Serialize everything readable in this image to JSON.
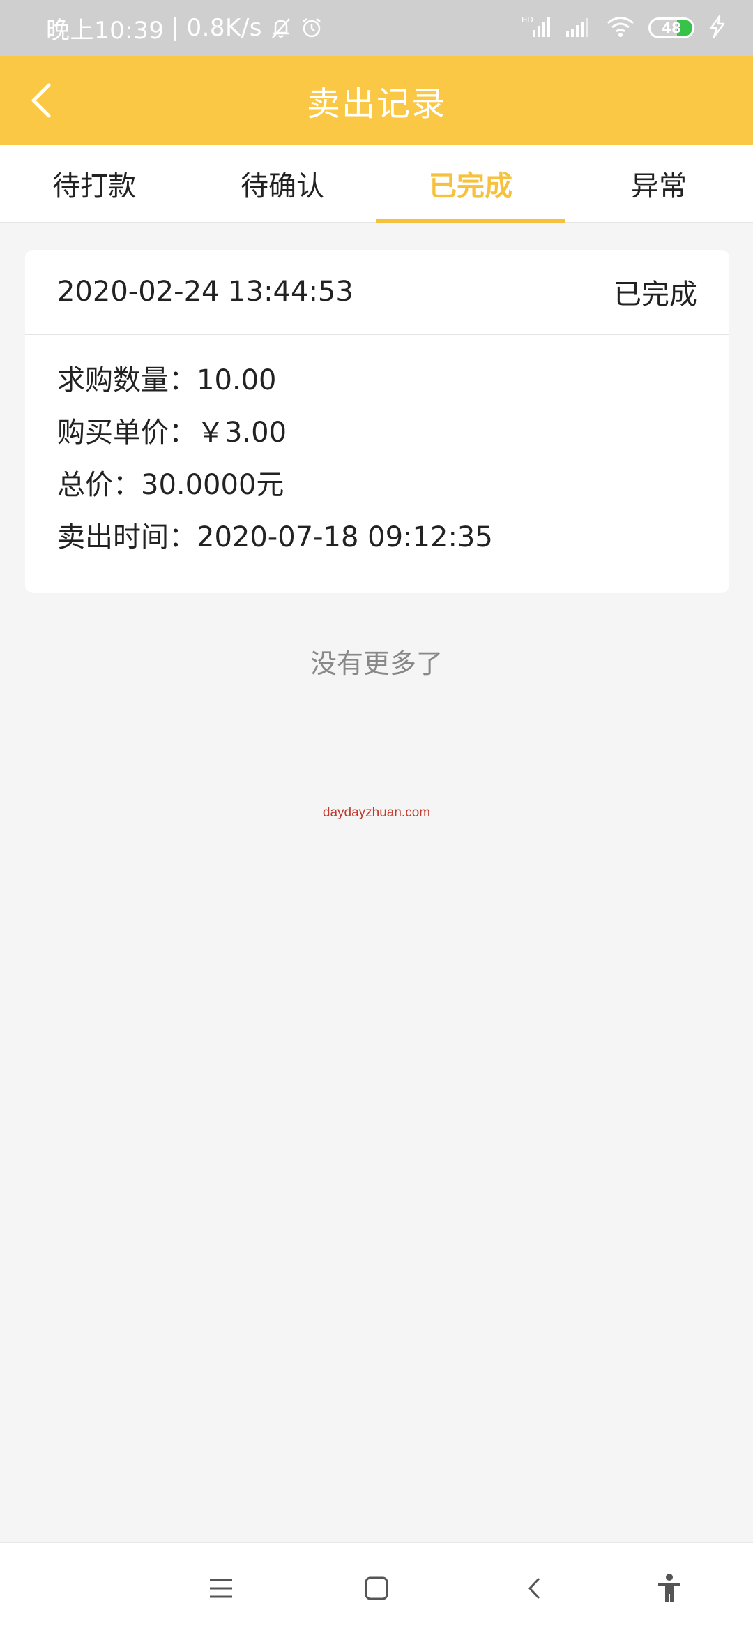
{
  "status_bar": {
    "time": "晚上10:39",
    "separator": "|",
    "network_speed": "0.8K/s",
    "battery_level": "48",
    "icons": [
      "bell-off-icon",
      "alarm-icon",
      "hd-signal-icon",
      "signal-icon",
      "wifi-icon",
      "battery-icon",
      "charging-icon"
    ],
    "battery_color": "#37c24a"
  },
  "header": {
    "title": "卖出记录",
    "back_icon": "back-arrow-icon",
    "background": "#fac845"
  },
  "tabs": [
    {
      "label": "待打款",
      "active": false
    },
    {
      "label": "待确认",
      "active": false
    },
    {
      "label": "已完成",
      "active": true
    },
    {
      "label": "异常",
      "active": false
    }
  ],
  "accent_color": "#f6c23e",
  "record": {
    "datetime": "2020-02-24 13:44:53",
    "status": "已完成",
    "quantity": "求购数量：10.00",
    "unit_price": "购买单价：￥3.00",
    "total": "总价：30.0000元",
    "sell_time": "卖出时间：2020-07-18 09:12:35"
  },
  "list_end_text": "没有更多了",
  "watermark": "daydayzhuan.com",
  "nav_bar": {
    "icons": [
      "menu-icon",
      "home-square-icon",
      "back-chevron-icon",
      "accessibility-icon"
    ]
  }
}
